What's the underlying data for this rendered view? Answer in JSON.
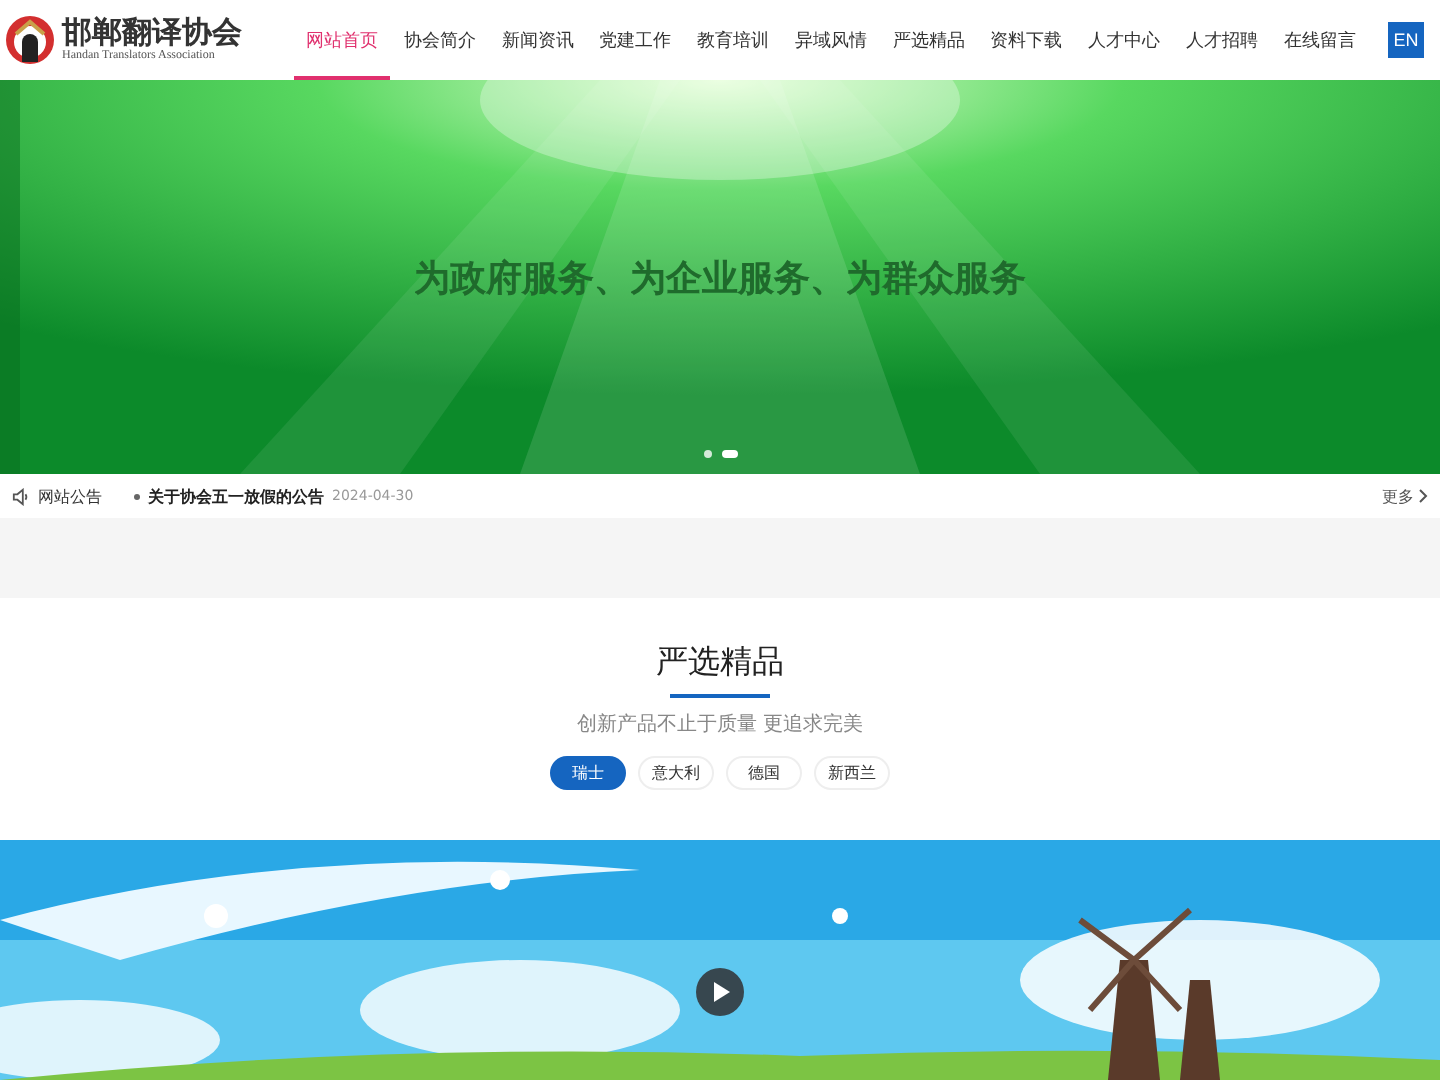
{
  "logo": {
    "name": "邯郸翻译协会",
    "subtitle": "Handan Translators Association"
  },
  "nav": [
    {
      "label": "网站首页",
      "selected": true
    },
    {
      "label": "协会简介",
      "selected": false
    },
    {
      "label": "新闻资讯",
      "selected": false
    },
    {
      "label": "党建工作",
      "selected": false
    },
    {
      "label": "教育培训",
      "selected": false
    },
    {
      "label": "异域风情",
      "selected": false
    },
    {
      "label": "严选精品",
      "selected": false
    },
    {
      "label": "资料下载",
      "selected": false
    },
    {
      "label": "人才中心",
      "selected": false
    },
    {
      "label": "人才招聘",
      "selected": false
    },
    {
      "label": "在线留言",
      "selected": false
    }
  ],
  "language_button": "EN",
  "banner": {
    "slogan": "为政府服务、为企业服务、为群众服务",
    "dots": [
      {
        "selected": false
      },
      {
        "selected": true
      }
    ]
  },
  "notice": {
    "label": "网站公告",
    "title": "关于协会五一放假的公告",
    "date": "2024-04-30",
    "more": "更多"
  },
  "section": {
    "title": "严选精品",
    "subtitle": "创新产品不止于质量 更追求完美",
    "tabs": [
      {
        "label": "瑞士",
        "selected": true
      },
      {
        "label": "意大利",
        "selected": false
      },
      {
        "label": "德国",
        "selected": false
      },
      {
        "label": "新西兰",
        "selected": false
      }
    ]
  }
}
